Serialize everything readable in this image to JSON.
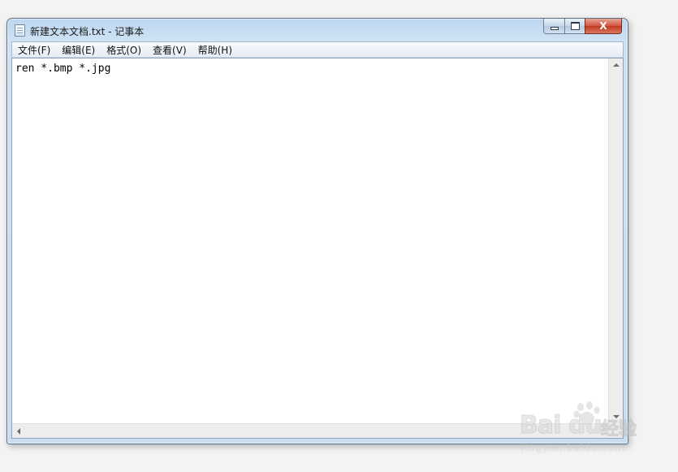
{
  "window": {
    "title": "新建文本文档.txt - 记事本",
    "close_glyph": "X"
  },
  "menu": {
    "items": [
      {
        "label": "文件(F)"
      },
      {
        "label": "编辑(E)"
      },
      {
        "label": "格式(O)"
      },
      {
        "label": "查看(V)"
      },
      {
        "label": "帮助(H)"
      }
    ]
  },
  "editor": {
    "content": "ren *.bmp *.jpg"
  },
  "watermark": {
    "brand": "Bai du",
    "product": "经验",
    "url": "jingyan.baidu.com"
  },
  "icons": {
    "app": "notepad-icon",
    "minimize": "minimize-icon",
    "maximize": "maximize-icon",
    "close": "close-icon"
  }
}
